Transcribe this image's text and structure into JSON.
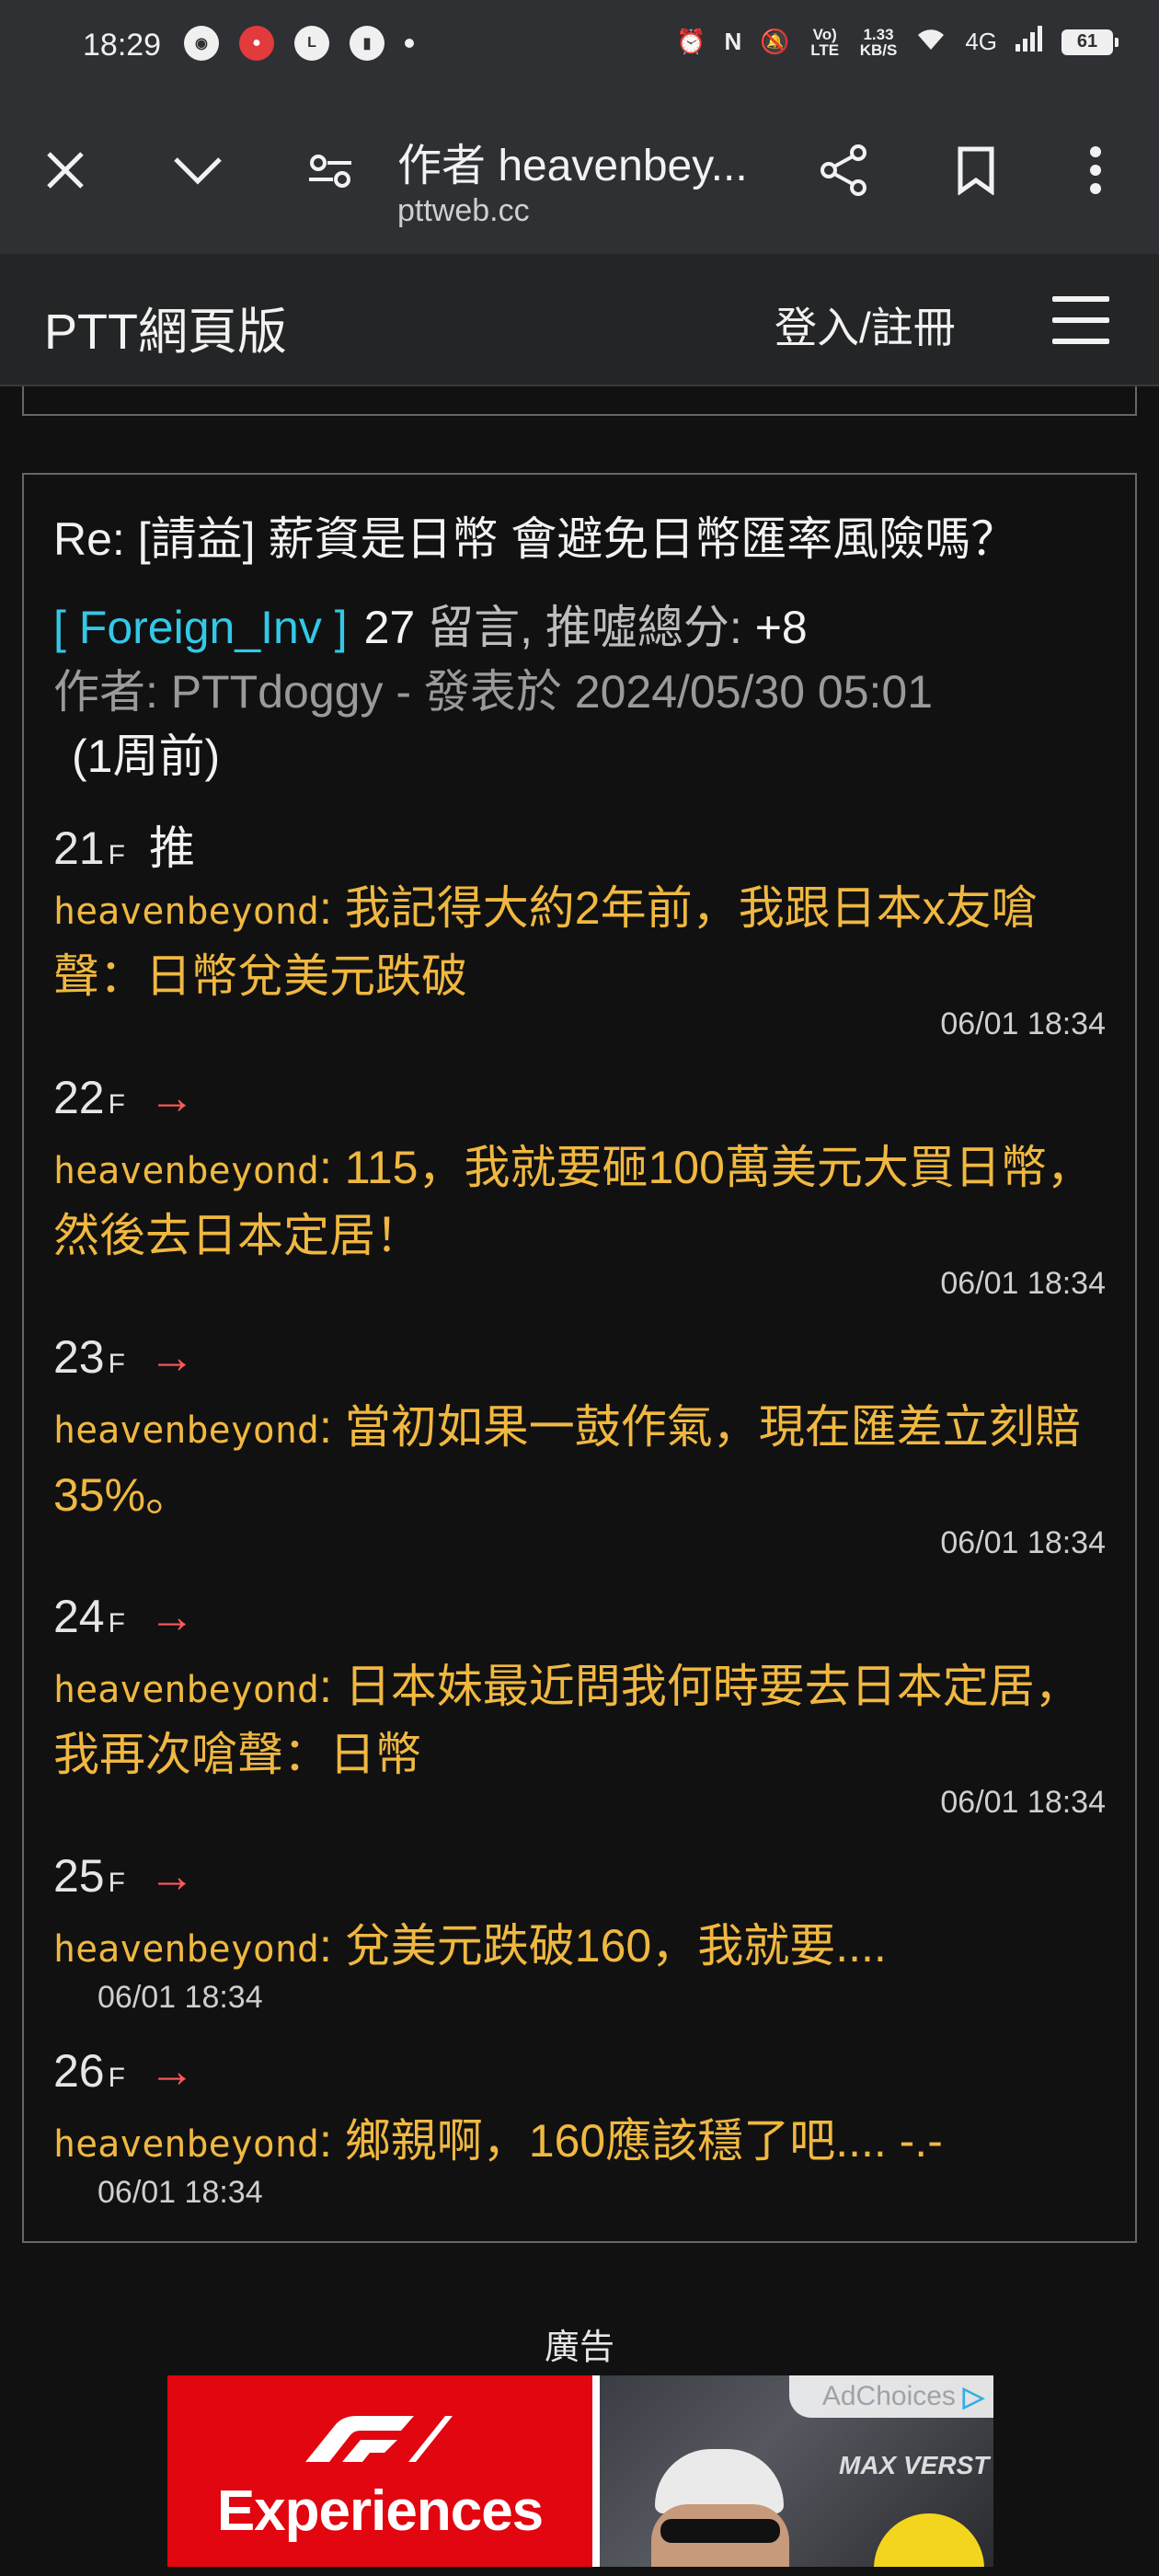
{
  "status_bar": {
    "time": "18:29",
    "app_icons": [
      "discord-icon",
      "red-app-icon",
      "line-icon",
      "twitch-icon"
    ],
    "netspeed_value": "1.33",
    "netspeed_unit": "KB/S",
    "network": "4G",
    "volte": "Vo) LTE",
    "battery": "61"
  },
  "browser": {
    "page_title": "作者 heavenbey...",
    "host": "pttweb.cc"
  },
  "site": {
    "title": "PTT網頁版",
    "login_label": "登入/註冊"
  },
  "post": {
    "title": "Re: [請益] 薪資是日幣 會避免日幣匯率風險嗎？",
    "board": "[ Foreign_Inv ]",
    "comment_count": "27",
    "comment_label": "留言, 推噓總分:",
    "score": "+8",
    "author_line": "作者: PTTdoggy - 發表於 2024/05/30 05:01",
    "ago": "(1周前)"
  },
  "comments": [
    {
      "floor": "21",
      "f": "F",
      "tag": "推",
      "user": "heavenbeyond",
      "text": ": 我記得大約2年前，我跟日本x友嗆聲：日幣兌美元跌破",
      "time": "06/01 18:34"
    },
    {
      "floor": "22",
      "f": "F",
      "tag": "→",
      "user": "heavenbeyond",
      "text": ": 115，我就要砸100萬美元大買日幣，然後去日本定居！",
      "time": "06/01 18:34"
    },
    {
      "floor": "23",
      "f": "F",
      "tag": "→",
      "user": "heavenbeyond",
      "text": ": 當初如果一鼓作氣，現在匯差立刻賠35%。",
      "time": "06/01 18:34"
    },
    {
      "floor": "24",
      "f": "F",
      "tag": "→",
      "user": "heavenbeyond",
      "text": ": 日本妹最近問我何時要去日本定居，我再次嗆聲：日幣",
      "time": "06/01 18:34"
    },
    {
      "floor": "25",
      "f": "F",
      "tag": "→",
      "user": "heavenbeyond",
      "text": ": 兌美元跌破160，我就要....",
      "time": "06/01 18:34"
    },
    {
      "floor": "26",
      "f": "F",
      "tag": "→",
      "user": "heavenbeyond",
      "text": ": 鄉親啊，160應該穩了吧.... -.-",
      "time": "06/01 18:34"
    }
  ],
  "ad": {
    "label": "廣告",
    "headline": "Experiences",
    "adchoices": "AdChoices",
    "overlay": "MAX VERST"
  },
  "colors": {
    "background": "#111112",
    "board_link": "#33c8e6",
    "comment_text": "#f0b840",
    "arrow": "#ff5a5a",
    "ad_red": "#e1060f"
  }
}
